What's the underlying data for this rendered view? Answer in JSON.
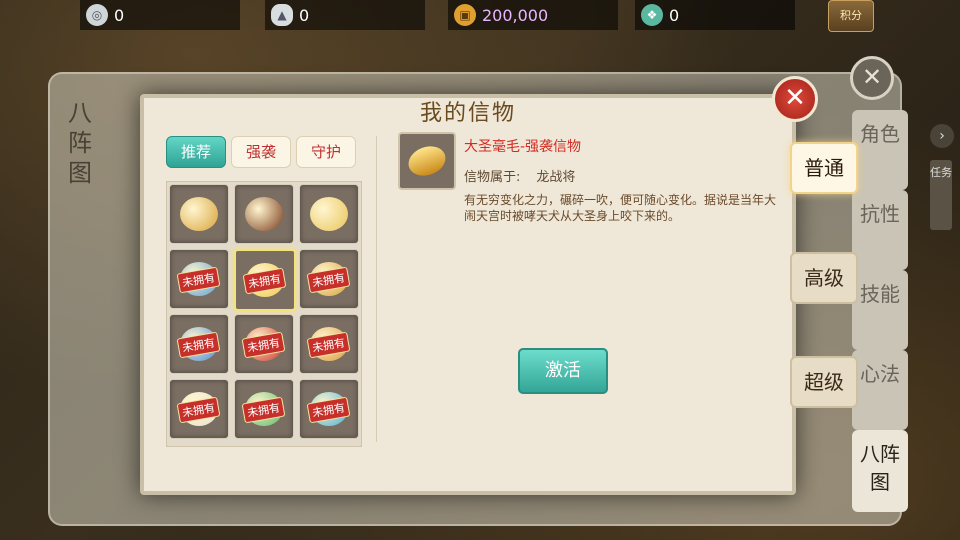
{
  "resources": {
    "silver_coin": {
      "value": "0"
    },
    "silver_ingot": {
      "value": "0"
    },
    "copper_coin": {
      "value": "200,000"
    },
    "jade": {
      "value": "0"
    },
    "points_label": "积分"
  },
  "background_panel": {
    "title": "八阵图",
    "side_tabs": [
      "角色",
      "抗性",
      "技能",
      "心法",
      "八阵图"
    ],
    "task_label": "任务"
  },
  "dialog": {
    "title": "我的信物",
    "subtabs": [
      {
        "label": "推荐",
        "active": true
      },
      {
        "label": "强袭",
        "active": false
      },
      {
        "label": "守护",
        "active": false
      }
    ],
    "grid": [
      {
        "icon": "ring-icon",
        "color": "#d8a23a",
        "locked": false
      },
      {
        "icon": "horn-icon",
        "color": "#7a3a1a",
        "locked": false
      },
      {
        "icon": "peach-icon",
        "color": "#e8c45a",
        "locked": false
      },
      {
        "icon": "blue-charm-icon",
        "color": "#5a9ed6",
        "locked": true
      },
      {
        "icon": "hair-icon",
        "color": "#f0c84a",
        "locked": true,
        "selected": true
      },
      {
        "icon": "staff-icon",
        "color": "#d8a23a",
        "locked": true
      },
      {
        "icon": "orb-icon",
        "color": "#4a8ad6",
        "locked": true
      },
      {
        "icon": "gourd-icon",
        "color": "#c8342a",
        "locked": true
      },
      {
        "icon": "bracelet-icon",
        "color": "#d89a3a",
        "locked": true
      },
      {
        "icon": "pearl-icon",
        "color": "#eae2d0",
        "locked": true
      },
      {
        "icon": "jade-icon",
        "color": "#5ab86a",
        "locked": true
      },
      {
        "icon": "mirror-icon",
        "color": "#4ab0d6",
        "locked": true
      }
    ],
    "lock_label": "未拥有",
    "detail": {
      "name": "大圣毫毛-强袭信物",
      "owner_label": "信物属于:",
      "owner_name": "龙战将",
      "description": "有无穷变化之力，碾碎一吹，便可随心变化。据说是当年大闹天宫时被哮天犬从大圣身上咬下来的。",
      "activate_label": "激活"
    },
    "grade_tabs": [
      "普通",
      "高级",
      "超级"
    ]
  }
}
